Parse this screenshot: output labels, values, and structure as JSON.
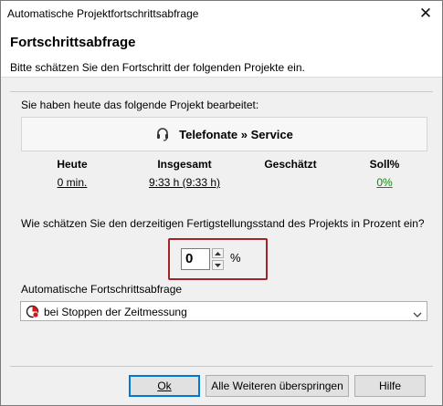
{
  "window": {
    "title": "Automatische Projektfortschrittsabfrage",
    "close_glyph": "✕"
  },
  "header": {
    "title": "Fortschrittsabfrage",
    "subtitle": "Bitte schätzen Sie den Fortschritt der folgenden Projekte ein."
  },
  "main": {
    "intro": "Sie haben heute das folgende Projekt bearbeitet:",
    "project": {
      "icon": "headset-icon",
      "name": "Telefonate » Service"
    },
    "stats": {
      "today_label": "Heute",
      "today_value": "0 min.",
      "total_label": "Insgesamt",
      "total_value": "9:33 h (9:33 h)",
      "estimated_label": "Geschätzt",
      "target_label": "Soll%",
      "target_value": "0%"
    },
    "question": "Wie schätzen Sie den derzeitigen Fertigstellungsstand des Projekts in Prozent ein?",
    "progress_input": {
      "value": "0",
      "unit": "%"
    },
    "auto_query": {
      "label": "Automatische Fortschrittsabfrage",
      "selected": "bei Stoppen der Zeitmessung",
      "icon": "stopwatch-icon"
    }
  },
  "buttons": {
    "ok": "Ok",
    "skip_all": "Alle Weiteren überspringen",
    "help": "Hilfe"
  },
  "colors": {
    "highlight_border": "#a3232b",
    "target_value": "#0f8a0f",
    "default_button_border": "#0078d7"
  }
}
